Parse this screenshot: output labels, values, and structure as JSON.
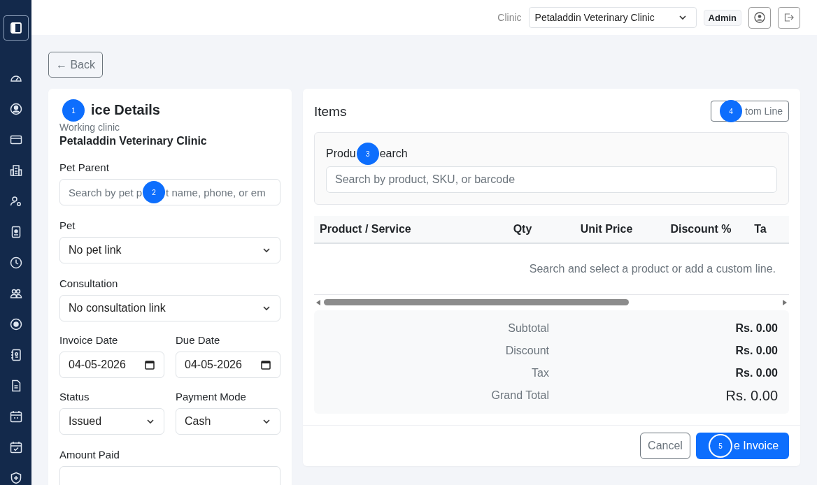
{
  "header": {
    "clinic_label": "Clinic",
    "clinic_select": "Petaladdin Veterinary Clinic",
    "role_badge": "Admin"
  },
  "back_button": "← Back",
  "details": {
    "title": "ice Details",
    "title_marker": "1",
    "subtitle": "Working clinic",
    "clinic": "Petaladdin Veterinary Clinic",
    "pet_parent": {
      "label": "Pet Parent",
      "placeholder_before": "Search by pet p",
      "marker": "2",
      "placeholder_after": "t name, phone, or em"
    },
    "pet": {
      "label": "Pet",
      "value": "No pet link"
    },
    "consultation": {
      "label": "Consultation",
      "value": "No consultation link"
    },
    "invoice_date": {
      "label": "Invoice Date",
      "value": "04-05-2026"
    },
    "due_date": {
      "label": "Due Date",
      "value": "04-05-2026"
    },
    "status": {
      "label": "Status",
      "value": "Issued"
    },
    "payment_mode": {
      "label": "Payment Mode",
      "value": "Cash"
    },
    "amount_paid": {
      "label": "Amount Paid"
    }
  },
  "items": {
    "title": "Items",
    "custom_line_button": "tom Line",
    "custom_line_marker": "4",
    "search": {
      "label_before": "Produ",
      "marker": "3",
      "label_after": "earch",
      "placeholder": "Search by product, SKU, or barcode"
    },
    "table": {
      "columns": [
        "Product / Service",
        "Qty",
        "Unit Price",
        "Discount %",
        "Ta"
      ],
      "empty_message": "Search and select a product or add a custom line."
    },
    "totals": [
      {
        "label": "Subtotal",
        "value": "Rs. 0.00",
        "kind": "normal"
      },
      {
        "label": "Discount",
        "value": "Rs. 0.00",
        "kind": "normal"
      },
      {
        "label": "Tax",
        "value": "Rs. 0.00",
        "kind": "normal"
      },
      {
        "label": "Grand Total",
        "value": "Rs. 0.00",
        "kind": "grand"
      }
    ],
    "cancel_button": "Cancel",
    "save_button": "e Invoice",
    "save_marker": "5"
  }
}
